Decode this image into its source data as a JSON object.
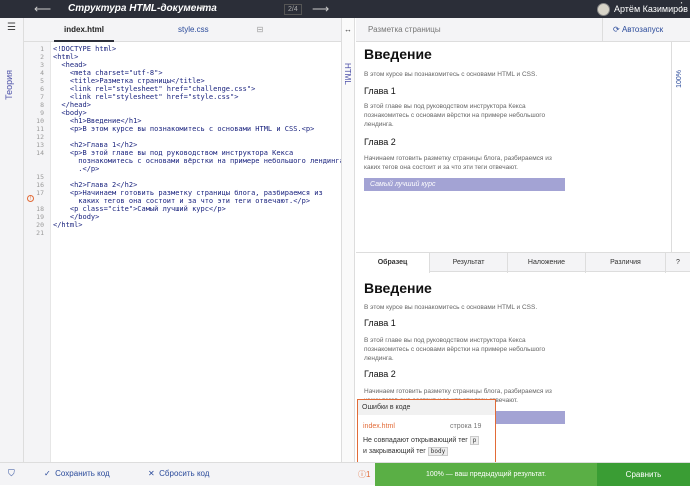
{
  "topbar": {
    "back_arrow": "⟵",
    "forward_arrow": "⟶",
    "title": "Структура HTML-документа",
    "counter": "2/4",
    "user_name": "Артём Казимиров"
  },
  "left_panel": {
    "label": "Теория"
  },
  "editor": {
    "tabs": [
      {
        "label": "index.html"
      },
      {
        "label": "style.css"
      }
    ],
    "side_label": "HTML",
    "lines": [
      {
        "n": "1",
        "text": "<!DOCTYPE html>"
      },
      {
        "n": "2",
        "text": "<html>"
      },
      {
        "n": "3",
        "text": "  <head>"
      },
      {
        "n": "4",
        "text": "    <meta charset=\"utf-8\">"
      },
      {
        "n": "5",
        "text": "    <title>Разметка страницы</title>"
      },
      {
        "n": "6",
        "text": "    <link rel=\"stylesheet\" href=\"challenge.css\">"
      },
      {
        "n": "7",
        "text": "    <link rel=\"stylesheet\" href=\"style.css\">"
      },
      {
        "n": "8",
        "text": "  </head>"
      },
      {
        "n": "9",
        "text": "  <body>"
      },
      {
        "n": "10",
        "text": "    <h1>Введение</h1>"
      },
      {
        "n": "11",
        "text": "    <p>В этом курсе вы познакомитесь с основами HTML и CSS.<p>"
      },
      {
        "n": "12",
        "text": ""
      },
      {
        "n": "13",
        "text": "    <h2>Глава 1</h2>"
      },
      {
        "n": "14",
        "text": "    <p>В этой главе вы под руководством инструктора Кекса"
      },
      {
        "n": "",
        "text": "      познакомитесь с основами вёрстки на примере небольшого лендинга"
      },
      {
        "n": "",
        "text": "      .</p>"
      },
      {
        "n": "15",
        "text": ""
      },
      {
        "n": "16",
        "text": "    <h2>Глава 2</h2>"
      },
      {
        "n": "17",
        "text": "    <p>Начинаем готовить разметку страницы блога, разбираемся из"
      },
      {
        "n": "",
        "text": "      каких тегов она состоит и за что эти теги отвечают.</p>"
      },
      {
        "n": "18",
        "text": "    <p class=\"cite\">Самый лучший курс</p>"
      },
      {
        "n": "19",
        "text": "    </body>"
      },
      {
        "n": "20",
        "text": "</html>"
      },
      {
        "n": "21",
        "text": ""
      }
    ]
  },
  "preview": {
    "header_label": "Разметка страницы",
    "autorun_label": "Автозапуск",
    "zoom": "100%",
    "h1": "Введение",
    "p1": "В этом курсе вы познакомитесь с основами HTML и CSS.",
    "h2a": "Глава 1",
    "p2": "В этой главе вы под руководством инструктора Кекса познакомитесь с основами вёрстки на примере небольшого лендинга.",
    "h2b": "Глава 2",
    "p3": "Начинаем готовить разметку страницы блога, разбираемся из каких тегов она состоит и за что эти теги отвечают.",
    "cite": "Самый лучший курс"
  },
  "bottom_tabs": [
    {
      "label": "Образец"
    },
    {
      "label": "Результат"
    },
    {
      "label": "Наложение"
    },
    {
      "label": "Различия"
    },
    {
      "label": "?"
    }
  ],
  "error_popup": {
    "title": "Ошибки в коде",
    "file": "index.html",
    "line": "строка 19",
    "msg_before": "Не совпадают открывающий тег",
    "tag_open": "p",
    "msg_middle": "и закрывающий тег",
    "tag_close": "body"
  },
  "bottom_bar": {
    "save_label": "Сохранить код",
    "reset_label": "Сбросить код",
    "error_count": "1",
    "result_text": "100% — ваш предыдущий результат.",
    "compare_label": "Сравнить"
  },
  "colors": {
    "accent": "#2b4b9b",
    "error": "#e26b37",
    "success": "#5aaf45",
    "cite_bg": "#a3a3d4",
    "topbar": "#2b2e38"
  }
}
